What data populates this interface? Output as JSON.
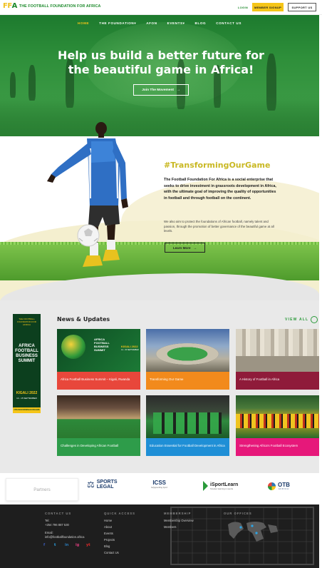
{
  "header": {
    "logo_mark_a": "FF",
    "logo_mark_b": "A",
    "logo_text": "THE FOOTBALL FOUNDATION FOR AFRICA",
    "login": "LOGIN",
    "member_signup": "MEMBER SIGNUP",
    "support": "SUPPORT US"
  },
  "nav": {
    "items": [
      "HOME",
      "THE FOUNDATION",
      "AFON",
      "EVENTS",
      "BLOG",
      "CONTACT US"
    ],
    "dropdown_marker": "▾"
  },
  "hero": {
    "headline_line1": "Help us build a better future for",
    "headline_line2": "the beautiful game in Africa!",
    "cta": "Join The Movement",
    "cta_arrow": "→"
  },
  "about": {
    "tagline": "#TransformingOurGame",
    "bold_text": "The Football Foundation For Africa is a social enterprise that seeks to drive investment in grassroots development in Africa, with the ultimate goal of improving the quality of opportunities in football and through football on the continent.",
    "small_text": "We also aim to protect the foundations of African football, namely talent and passion, through the promotion of better governance of the beautiful game at all levels.",
    "cta": "Learn More",
    "cta_arrow": "→"
  },
  "banner": {
    "top": "THE FOOTBALL FOUNDATION FOR AFRICA",
    "title": "AFRICA FOOTBALL BUSINESS SUMMIT",
    "city": "KIGALI 2022",
    "dates": "14 - 15 SEPTEMBER",
    "footer": "#TRANSFORMINGOURGAME"
  },
  "news": {
    "title": "News & Updates",
    "view_all": "VIEW ALL",
    "cards": [
      {
        "caption": "Africa Football Business Summit – Kigali, Rwanda",
        "color": "#e8473b"
      },
      {
        "caption": "Transforming Our Game",
        "color": "#f28a1c"
      },
      {
        "caption": "A History of Football in Africa",
        "color": "#8f1b3a"
      },
      {
        "caption": "Challenges in Developing African Football",
        "color": "#2e9c4a"
      },
      {
        "caption": "Education Essential for Football Development in Africa",
        "color": "#1f8fd6"
      },
      {
        "caption": "Strengthening Africa's Football Ecosystem",
        "color": "#e6187a"
      }
    ],
    "card1_title": "AFRICA FOOTBALL BUSINESS SUMMIT",
    "card1_city": "KIGALI 2022",
    "card1_dates": "14 - 15 SEPTEMBER"
  },
  "partners": {
    "label": "Partners",
    "logos": [
      {
        "name": "SPORTS LEGAL"
      },
      {
        "name": "ICSS",
        "sub": "Safeguarding Sport"
      },
      {
        "name": "iSportLearn",
        "sub": "Smarter learning in sports"
      },
      {
        "name": "OTB",
        "sub": "AFRICA"
      }
    ]
  },
  "footer": {
    "contact_head": "CONTACT US",
    "tel_label": "Tel:",
    "tel": "+254 796 887 530",
    "email_label": "Email:",
    "email": "info@footballfoundation.africa",
    "quick_head": "QUICK ACCESS",
    "quick_links": [
      "Home",
      "About",
      "Events",
      "Projects",
      "Blog",
      "Contact Us"
    ],
    "member_head": "MEMBERSHIP",
    "member_links": [
      "Membership Overview",
      "Members"
    ],
    "offices_head": "OUR OFFICES",
    "social": [
      "f",
      "t",
      "in",
      "ig",
      "yt"
    ]
  },
  "colors": {
    "brand_green": "#1d8a2c",
    "accent_yellow": "#f5c518",
    "tagline_gold": "#c9b823"
  }
}
